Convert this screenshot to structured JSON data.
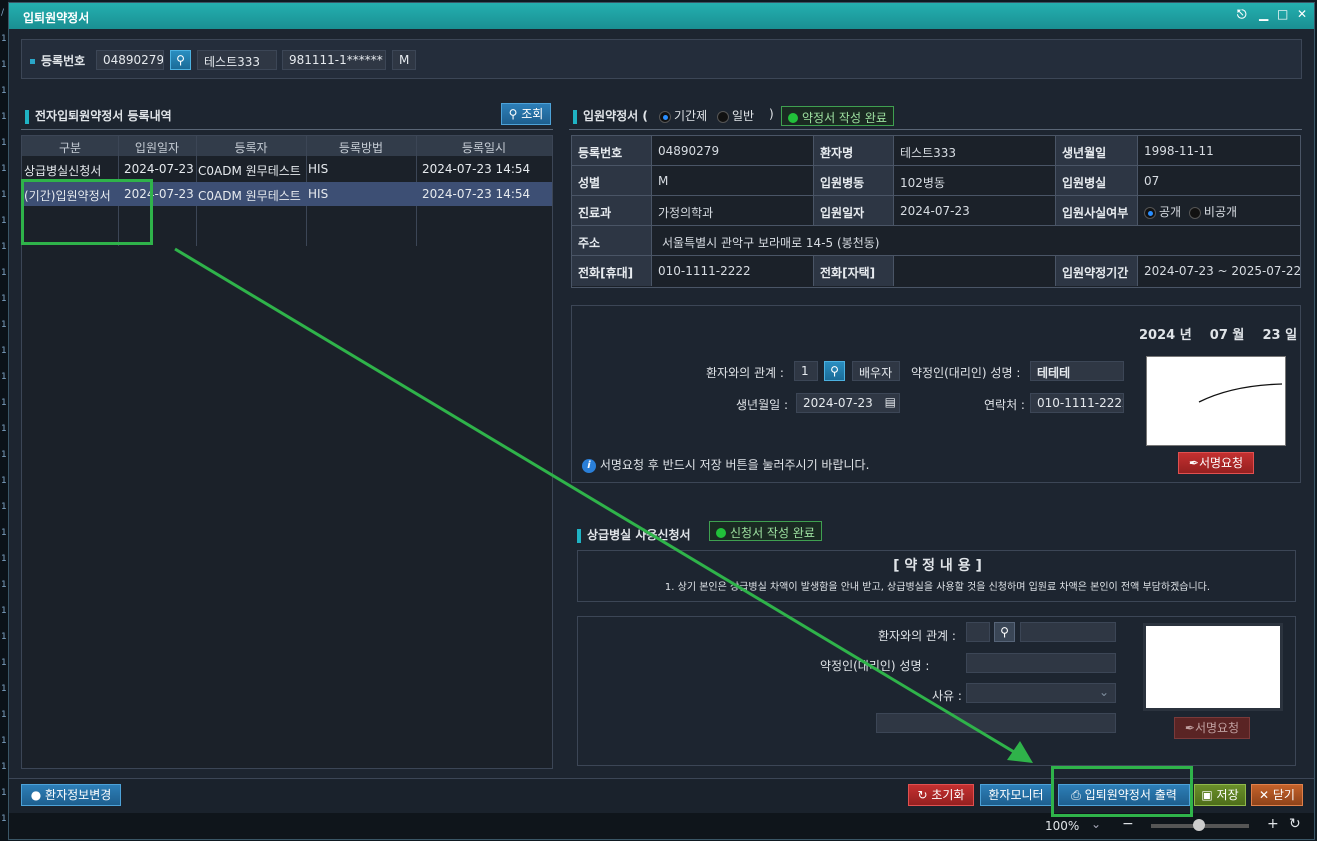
{
  "window": {
    "title": "입퇴원약정서",
    "controls": [
      "▌",
      "▁",
      "□",
      "✕"
    ]
  },
  "patient_bar": {
    "label": "등록번호",
    "reg_no": "04890279",
    "name": "테스트333",
    "resident_no": "981111-1******",
    "sex": "M"
  },
  "left": {
    "section_title": "전자입퇴원약정서 등록내역",
    "search_button": "조회",
    "columns": [
      "구분",
      "입원일자",
      "등록자",
      "등록방법",
      "등록일시"
    ],
    "rows": [
      {
        "type": "상급병실신청서",
        "date": "2024-07-23",
        "registrant": "C0ADM 원무테스트",
        "method": "HIS",
        "registered_at": "2024-07-23 14:54"
      },
      {
        "type": "(기간)입원약정서",
        "date": "2024-07-23",
        "registrant": "C0ADM 원무테스트",
        "method": "HIS",
        "registered_at": "2024-07-23 14:54"
      }
    ]
  },
  "right": {
    "section_title": "입원약정서 (",
    "section_close": ")",
    "radio_period": "기간제",
    "radio_general": "일반",
    "status": "약정서 작성 완료",
    "info": {
      "reg_no_label": "등록번호",
      "reg_no": "04890279",
      "name_label": "환자명",
      "name": "테스트333",
      "birth_label": "생년월일",
      "birth": "1998-11-11",
      "sex_label": "성별",
      "sex": "M",
      "ward_label": "입원병동",
      "ward": "102병동",
      "room_label": "입원병실",
      "room": "07",
      "dept_label": "진료과",
      "dept": "가정의학과",
      "adm_date_label": "입원일자",
      "adm_date": "2024-07-23",
      "disclose_label": "입원사실여부",
      "disclose_public": "공개",
      "disclose_private": "비공개",
      "address_label": "주소",
      "address": "서울특별시 관악구 보라매로 14-5 (봉천동)",
      "mobile_label": "전화[휴대]",
      "mobile": "010-1111-2222",
      "home_label": "전화[자택]",
      "home": "",
      "period_label": "입원약정기간",
      "period": "2024-07-23 ~ 2025-07-22"
    },
    "sign": {
      "date_year": "2024",
      "date_year_unit": "년",
      "date_month": "07",
      "date_month_unit": "월",
      "date_day": "23",
      "date_day_unit": "일",
      "relation_label": "환자와의 관계 :",
      "relation_code": "1",
      "relation_name": "배우자",
      "signer_label": "약정인(대리인) 성명 :",
      "signer_name": "테테테",
      "birth_label": "생년월일 :",
      "birth": "2024-07-23",
      "contact_label": "연락처 :",
      "contact": "010-1111-2222",
      "notice": "서명요청 후 반드시 저장 버튼을 눌러주시기 바랍니다.",
      "sign_button": "서명요청"
    },
    "upper_room": {
      "title": "상급병실 사용신청서",
      "status": "신청서 작성 완료",
      "content_title": "[ 약 정 내 용 ]",
      "content_text": "1. 상기 본인은 상급병실 차액이 발생함을 안내 받고, 상급병실을 사용할 것을 신청하며 입원료 차액은 본인이 전액 부담하겠습니다.",
      "relation_label": "환자와의 관계 :",
      "signer_label": "약정인(대리인) 성명 :",
      "reason_label": "사유 :",
      "sign_button": "서명요청"
    }
  },
  "bottom": {
    "patient_info_button": "환자정보변경",
    "reset_button": "초기화",
    "monitor_button": "환자모니터",
    "print_button": "입퇴원약정서 출력",
    "save_button": "저장",
    "close_button": "닫기"
  },
  "statusbar": {
    "zoom": "100%"
  },
  "colors": {
    "accent": "#1fb3c4",
    "highlight_annotation": "#2fb34a",
    "selected_row": "#3d4f74"
  }
}
